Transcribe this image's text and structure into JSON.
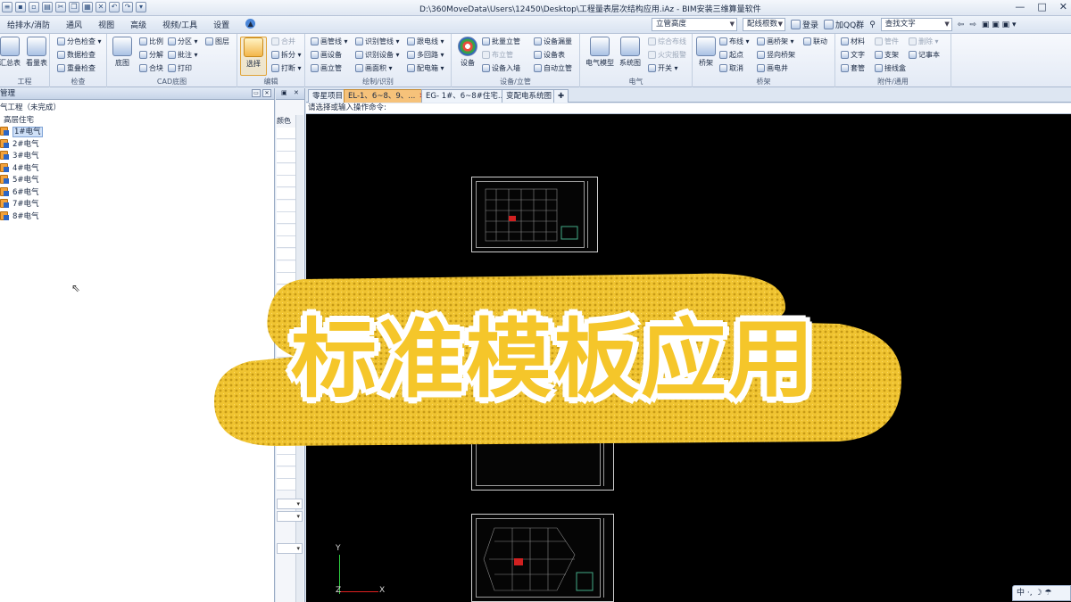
{
  "window": {
    "title": "D:\\360MoveData\\Users\\12450\\Desktop\\工程量表层次结构应用.iAz - BIM安装三维算量软件",
    "controls": [
      "—",
      "□",
      "✕"
    ]
  },
  "menu": {
    "tabs": [
      "给排水/消防",
      "通风",
      "视图",
      "高级",
      "视频/工具",
      "设置"
    ],
    "search_combo": "立管高度",
    "search_combo2": "配线根数",
    "login": "登录",
    "qq": "加QQ群",
    "find_placeholder": "查找文字"
  },
  "ribbon": {
    "groups": [
      {
        "label": "工程",
        "big": [
          "汇总表",
          "看量表"
        ]
      },
      {
        "label": "检查",
        "small": [
          "分色检查",
          "数据检查",
          "重叠检查"
        ]
      },
      {
        "label": "CAD底图",
        "big": [
          "底图"
        ],
        "small": [
          "比例",
          "分解",
          "合块",
          "分区",
          "批注",
          "打印",
          "图层"
        ]
      },
      {
        "label": "编辑",
        "big": [
          "选择"
        ],
        "small": [
          "合并",
          "拆分",
          "打断"
        ]
      },
      {
        "label": "绘制/识别",
        "small": [
          "画管线",
          "画设备",
          "画立管",
          "识别管线",
          "识别设备",
          "画面积",
          "跟电线",
          "多回路",
          "配电箱"
        ]
      },
      {
        "label": "设备/立管",
        "big": [
          "设备"
        ],
        "small": [
          "批量立管",
          "布立管",
          "设备入墙",
          "设备漏量",
          "设备表",
          "自动立管"
        ]
      },
      {
        "label": "电气",
        "big": [
          "电气模型",
          "系统图"
        ],
        "small": [
          "综合布线",
          "火灾报警",
          "开关"
        ]
      },
      {
        "label": "桥架",
        "big": [
          "桥架"
        ],
        "small": [
          "布线",
          "起点",
          "取消",
          "画桥架",
          "竖向桥架",
          "画电井",
          "联动"
        ]
      },
      {
        "label": "附件/通用",
        "small": [
          "材料",
          "文字",
          "套管",
          "管件",
          "支架",
          "接线盒",
          "删除",
          "记事本"
        ]
      }
    ]
  },
  "left_panel": {
    "title": "管理",
    "project": "气工程（未完成）",
    "category": "高层住宅",
    "items": [
      "1#电气",
      "2#电气",
      "3#电气",
      "4#电气",
      "5#电气",
      "6#电气",
      "7#电气",
      "8#电气"
    ],
    "selected": 0
  },
  "mid_panel": {
    "label": "颜色"
  },
  "doc_tabs": [
    {
      "label": "零星项目",
      "active": false
    },
    {
      "label": "EL-1、6~8、9、...",
      "active": true
    },
    {
      "label": "EG- 1#、6~8#住宅...",
      "active": false
    },
    {
      "label": "变配电系统图",
      "active": false
    }
  ],
  "command_prompt": "请选择或输入操作命令:",
  "axes": {
    "y": "Y",
    "x": "X",
    "z": "Z"
  },
  "overlay_title": "标准模板应用",
  "ime": "中 ·, ☽ ☂",
  "colors": {
    "accent": "#f5c62a",
    "stroke": "#163c9c",
    "canvas": "#000000"
  }
}
